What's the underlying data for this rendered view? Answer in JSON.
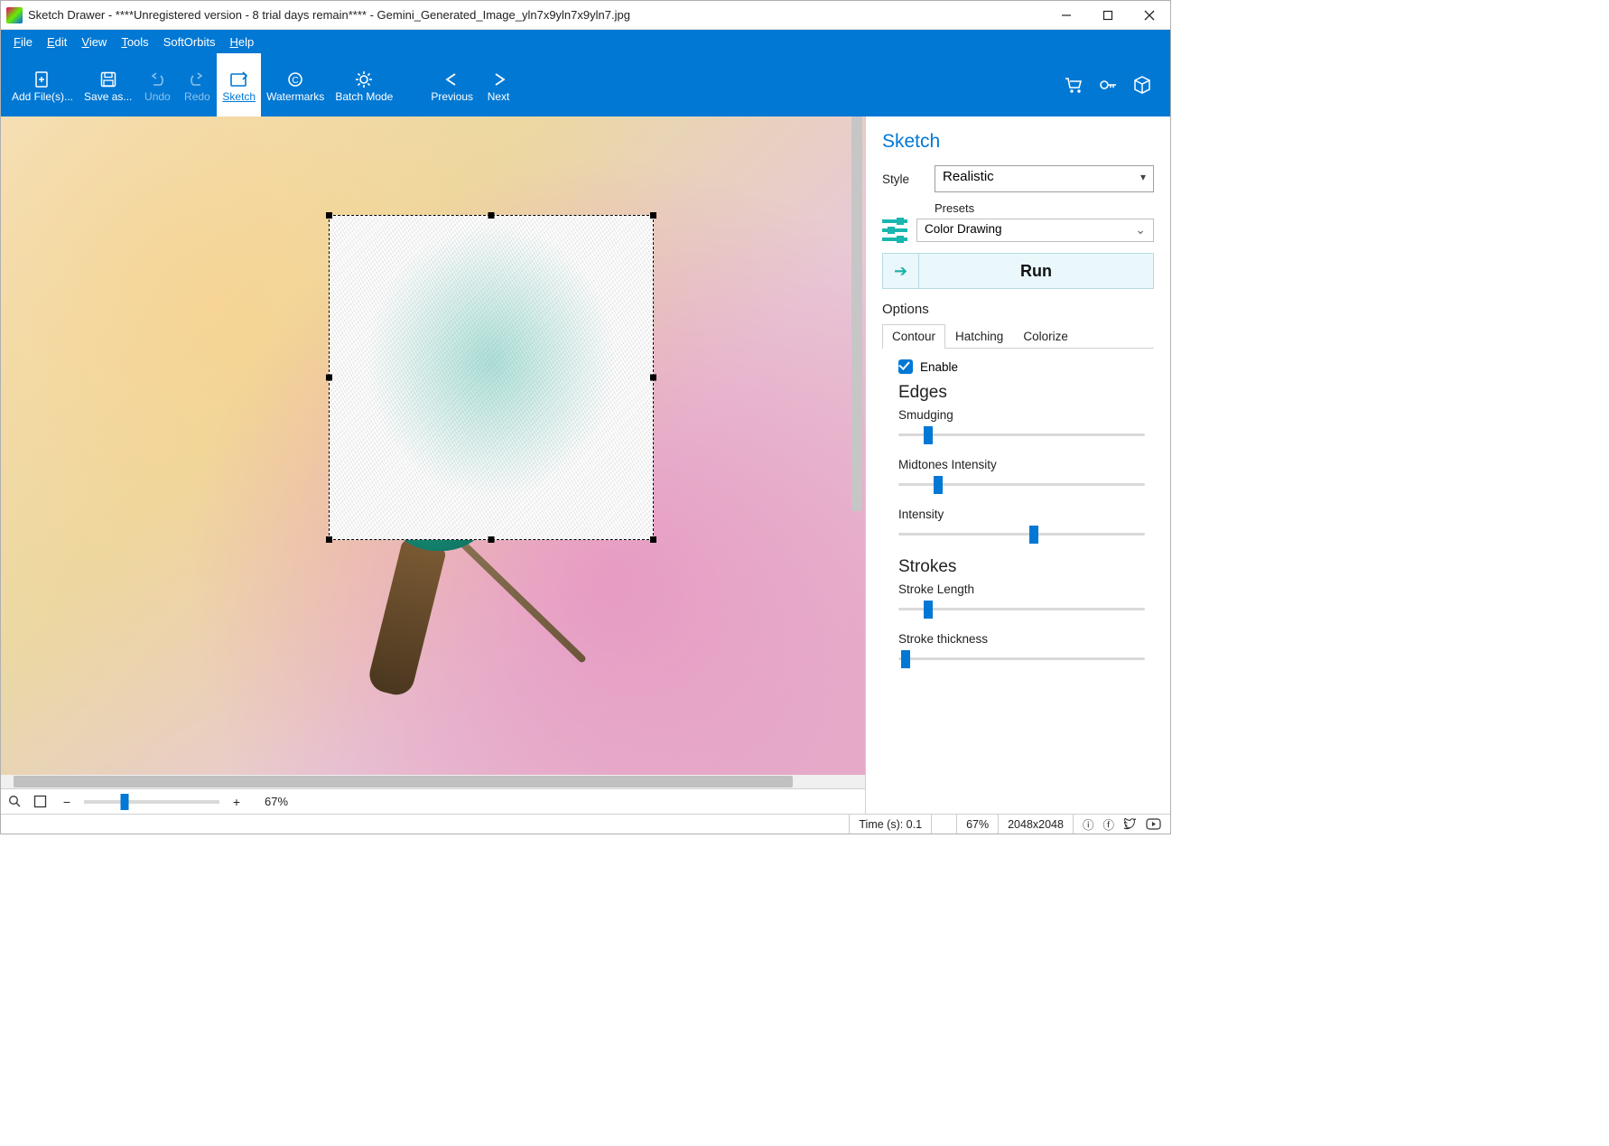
{
  "window": {
    "title": "Sketch Drawer - ****Unregistered version - 8 trial days remain**** - Gemini_Generated_Image_yln7x9yln7x9yln7.jpg"
  },
  "menu": {
    "file": "File",
    "edit": "Edit",
    "view": "View",
    "tools": "Tools",
    "softorbits": "SoftOrbits",
    "help": "Help"
  },
  "toolbar": {
    "add_files": "Add File(s)...",
    "save_as": "Save as...",
    "undo": "Undo",
    "redo": "Redo",
    "sketch": "Sketch",
    "watermarks": "Watermarks",
    "batch_mode": "Batch Mode",
    "previous": "Previous",
    "next": "Next"
  },
  "panel": {
    "title": "Sketch",
    "style_label": "Style",
    "style_value": "Realistic",
    "presets_label": "Presets",
    "presets_value": "Color Drawing",
    "run": "Run",
    "options": "Options",
    "tabs": {
      "contour": "Contour",
      "hatching": "Hatching",
      "colorize": "Colorize"
    },
    "enable": "Enable",
    "edges": "Edges",
    "smudging": "Smudging",
    "midtones": "Midtones Intensity",
    "intensity": "Intensity",
    "strokes": "Strokes",
    "stroke_length": "Stroke Length",
    "stroke_thickness": "Stroke thickness",
    "slider_values": {
      "smudging": 12,
      "midtones": 16,
      "intensity": 55,
      "stroke_length": 12,
      "stroke_thickness": 3
    }
  },
  "zoom": {
    "percent": "67%"
  },
  "status": {
    "time": "Time (s): 0.1",
    "percent": "67%",
    "resolution": "2048x2048"
  }
}
